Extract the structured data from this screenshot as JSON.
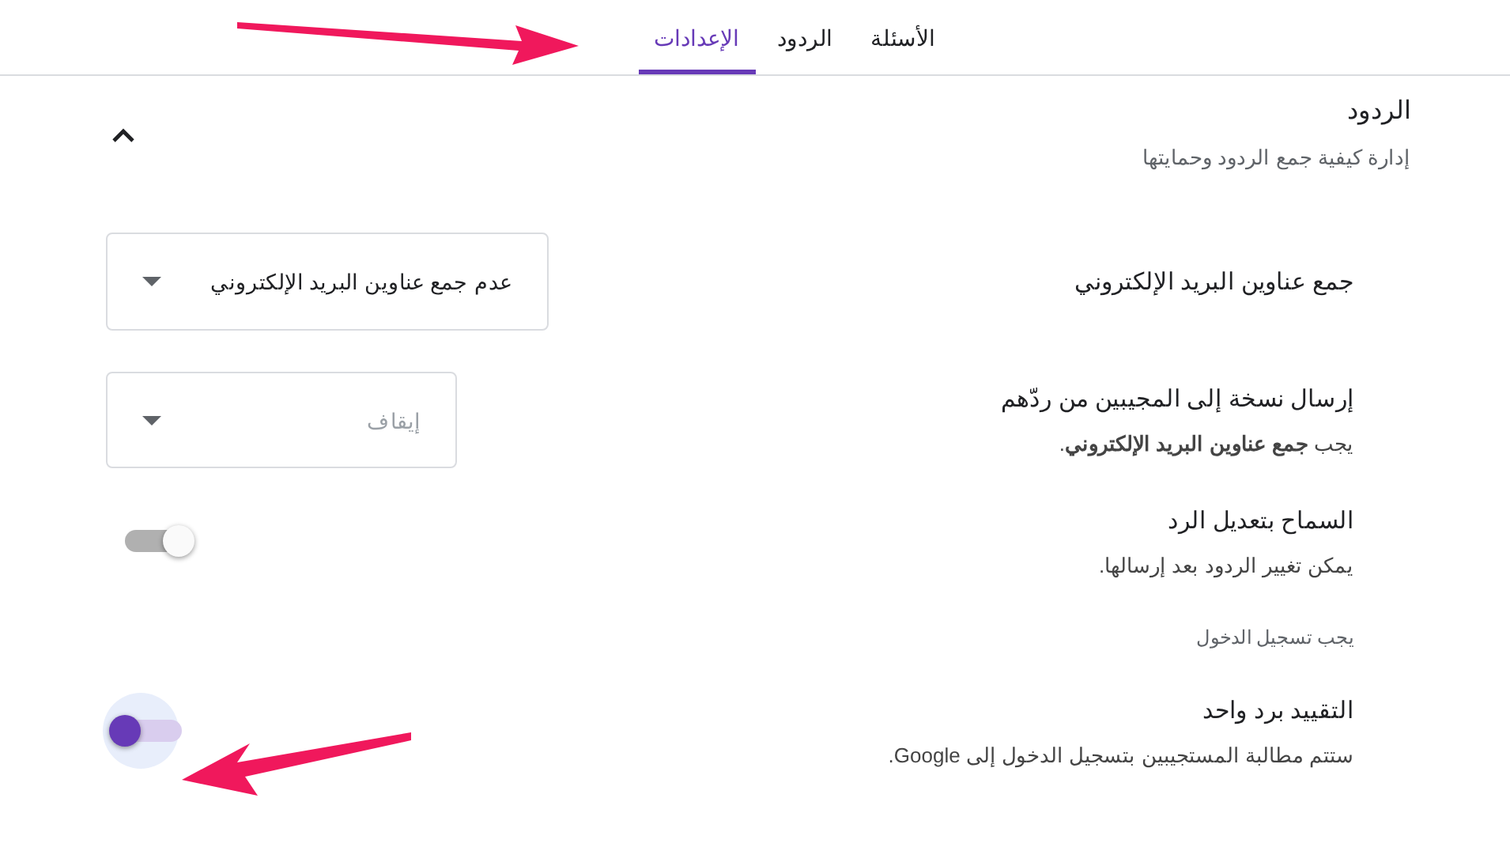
{
  "tabs": [
    {
      "label": "الأسئلة",
      "selected": false
    },
    {
      "label": "الردود",
      "selected": false
    },
    {
      "label": "الإعدادات",
      "selected": true
    }
  ],
  "section": {
    "title": "الردود",
    "subtitle": "إدارة كيفية جمع الردود وحمايتها",
    "expanded": true
  },
  "settings": [
    {
      "kind": "dropdown",
      "label": "جمع عناوين البريد الإلكتروني",
      "value": "عدم جمع عناوين البريد الإلكتروني",
      "disabled": false
    },
    {
      "kind": "dropdown",
      "label": "إرسال نسخة إلى المجيبين من ردّهم",
      "description": "يجب **جمع عناوين البريد الإلكتروني**.",
      "value": "إيقاف",
      "disabled": true
    },
    {
      "kind": "toggle",
      "label": "السماح بتعديل الرد",
      "description": "يمكن تغيير الردود بعد إرسالها.",
      "on": false
    },
    {
      "kind": "note",
      "label": "يجب تسجيل الدخول"
    },
    {
      "kind": "toggle",
      "label": "التقييد برد واحد",
      "description": "ستتم مطالبة المستجيبين بتسجيل الدخول إلى Google.",
      "on": true
    }
  ]
}
